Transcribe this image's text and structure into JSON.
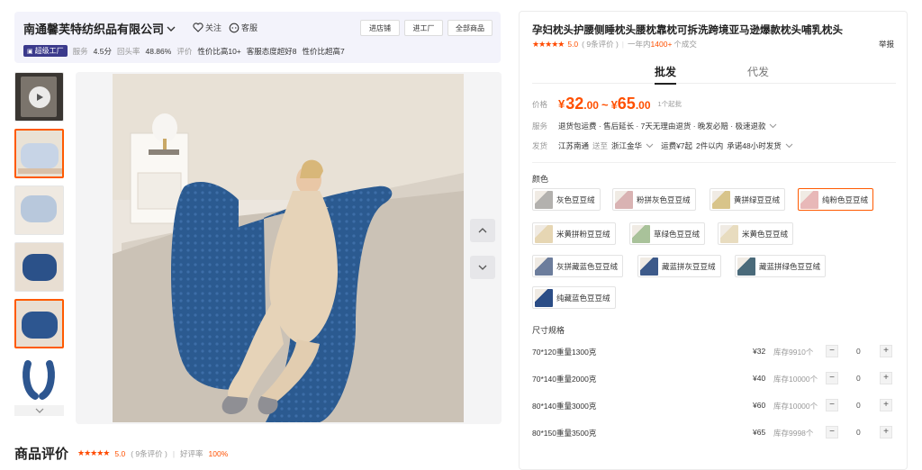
{
  "shop": {
    "name": "南通馨芙特纺织品有限公司",
    "follow": "关注",
    "report": "客服",
    "buttons": [
      "进店铺",
      "进工厂",
      "全部商品"
    ],
    "badge": "超级工厂",
    "service_label": "服务",
    "service_score": "4.5分",
    "repurchase_label": "回头率",
    "repurchase_value": "48.86%",
    "eval_label": "评价",
    "tags": [
      "性价比高10+",
      "客服态度超好8",
      "性价比超高7"
    ]
  },
  "review": {
    "title": "商品评价",
    "rating": "5.0",
    "count": "( 9条评价 )",
    "sep": "|",
    "good_label": "好评率",
    "good_rate": "100%"
  },
  "product": {
    "title": "孕妇枕头护腰侧睡枕头腰枕靠枕可拆洗跨境亚马逊爆款枕头哺乳枕头",
    "rating": "5.0",
    "reviews": "( 9条评价 )",
    "sales_prefix": "一年内",
    "sales_value": "1400+",
    "sales_suffix": "个成交",
    "report": "举报",
    "tabs": [
      "批发",
      "代发"
    ],
    "price_label": "价格",
    "price_currency": "¥",
    "price_low_int": "32",
    "price_low_dec": ".00",
    "price_sep": "~",
    "price_high_int": "65",
    "price_high_dec": ".00",
    "moq": "1个起批",
    "service_label": "服务",
    "services": "退货包运费 · 售后延长 · 7天无理由退货 · 晚发必赔 · 极速退款",
    "ship_label": "发货",
    "ship_from": "江苏南通",
    "ship_to_word": "送至",
    "ship_to": "浙江金华",
    "freight": "运费¥7起",
    "ship_within": "2件以内",
    "ship_promise": "承诺48小时发货",
    "color_label": "颜色",
    "colors": [
      {
        "name": "灰色豆豆绒",
        "color": "#b3b1ae"
      },
      {
        "name": "粉拼灰色豆豆绒",
        "color": "#d9b3b3"
      },
      {
        "name": "黄拼绿豆豆绒",
        "color": "#d8c48a"
      },
      {
        "name": "纯粉色豆豆绒",
        "color": "#e8b8b8"
      },
      {
        "name": "米黄拼粉豆豆绒",
        "color": "#e6d6b3"
      },
      {
        "name": "草绿色豆豆绒",
        "color": "#a9c29a"
      },
      {
        "name": "米黄色豆豆绒",
        "color": "#e8dcbf"
      },
      {
        "name": "灰拼藏蓝色豆豆绒",
        "color": "#6c7d9c"
      },
      {
        "name": "藏蓝拼灰豆豆绒",
        "color": "#3d5a8a"
      },
      {
        "name": "藏蓝拼绿色豆豆绒",
        "color": "#4a6a7a"
      },
      {
        "name": "纯藏蓝色豆豆绒",
        "color": "#2b4d86"
      }
    ],
    "size_label": "尺寸规格",
    "sizes": [
      {
        "name": "70*120重量1300克",
        "price": "¥32",
        "stock": "库存9910个",
        "qty": "0"
      },
      {
        "name": "70*140重量2000克",
        "price": "¥40",
        "stock": "库存10000个",
        "qty": "0"
      },
      {
        "name": "80*140重量3000克",
        "price": "¥60",
        "stock": "库存10000个",
        "qty": "0"
      },
      {
        "name": "80*150重量3500克",
        "price": "¥65",
        "stock": "库存9998个",
        "qty": "0"
      }
    ]
  },
  "accent": "#ff5000",
  "badge_color": "#3b3a8c"
}
